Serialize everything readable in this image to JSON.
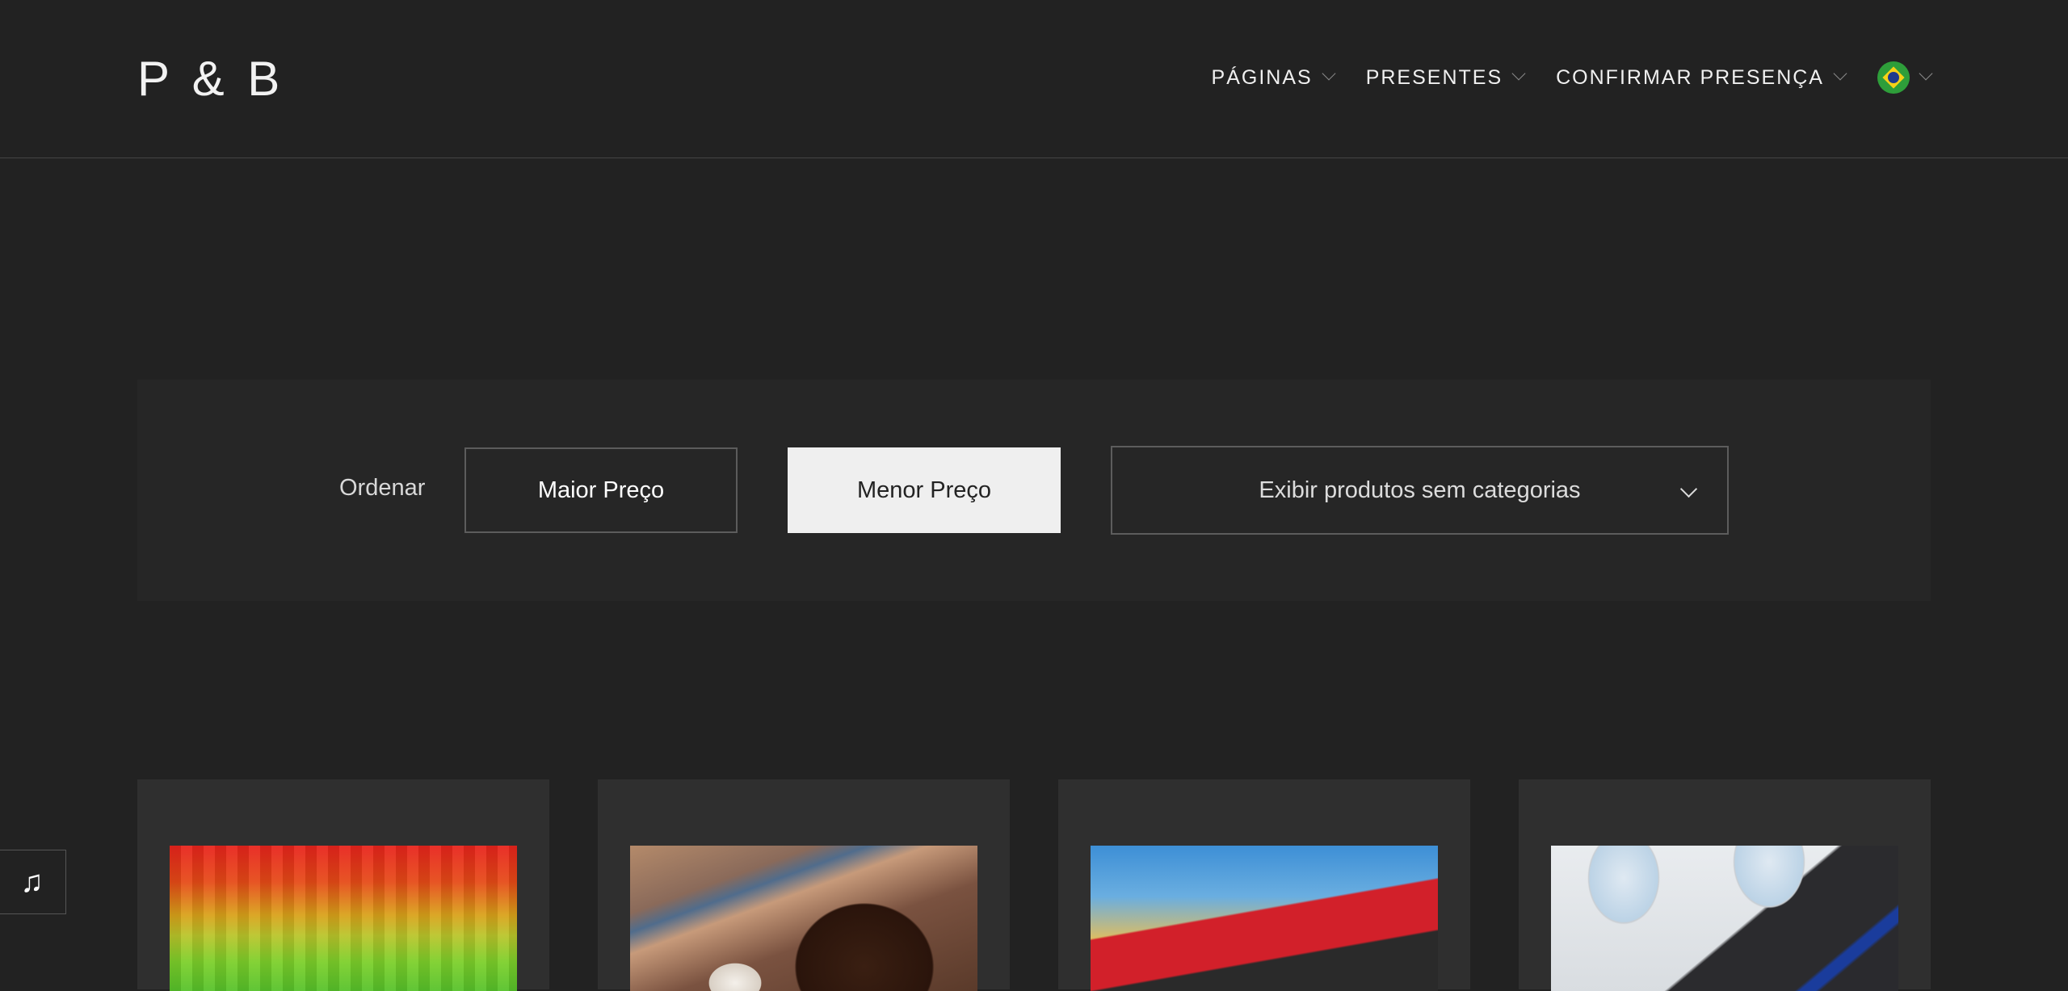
{
  "logo": "P & B",
  "nav": {
    "items": [
      {
        "label": "PÁGINAS"
      },
      {
        "label": "PRESENTES"
      },
      {
        "label": "CONFIRMAR PRESENÇA"
      }
    ],
    "language_icon": "brazil-flag-icon"
  },
  "filters": {
    "sort_label": "Ordenar",
    "highest_price": "Maior Preço",
    "lowest_price": "Menor Preço",
    "category_select": "Exibir produtos sem categorias"
  },
  "products": [
    {
      "image": "rainbow-pattern"
    },
    {
      "image": "brigadeiro"
    },
    {
      "image": "red-train"
    },
    {
      "image": "airplane-cabin"
    }
  ],
  "music_button": {
    "icon": "music-note-icon",
    "glyph": "♫"
  }
}
